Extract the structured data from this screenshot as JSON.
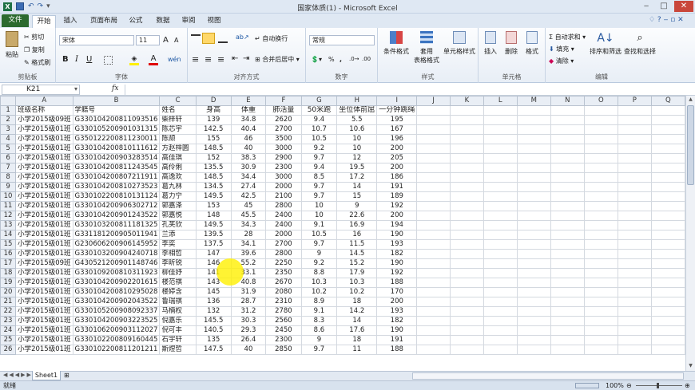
{
  "window": {
    "title": "国家体质(1)  -  Microsoft Excel"
  },
  "tabs": [
    "文件",
    "开始",
    "插入",
    "页面布局",
    "公式",
    "数据",
    "审阅",
    "视图"
  ],
  "ribbon": {
    "clipboard": {
      "label": "剪贴板",
      "paste": "粘贴",
      "cut": "剪切",
      "copy": "复制",
      "format_painter": "格式刷"
    },
    "font": {
      "label": "字体",
      "name": "宋体",
      "size": "11",
      "grow": "A",
      "shrink": "A",
      "bold": "B",
      "italic": "I",
      "underline": "U",
      "text_color": "A",
      "phonetic": "wén"
    },
    "alignment": {
      "label": "对齐方式",
      "wrap": "自动换行",
      "merge": "合并后居中"
    },
    "number": {
      "label": "数字",
      "format": "常规",
      "percent": "%"
    },
    "styles": {
      "label": "样式",
      "conditional": "条件格式",
      "table1": "套用",
      "table2": "表格格式",
      "cell_styles": "单元格样式"
    },
    "cells": {
      "label": "单元格",
      "insert": "插入",
      "delete": "删除",
      "format": "格式"
    },
    "editing": {
      "label": "编辑",
      "autosum": "自动求和",
      "fill": "填充",
      "clear": "清除",
      "sort": "排序和筛选",
      "find": "查找和选择"
    }
  },
  "formula_bar": {
    "name_box": "K21",
    "fx": "fx",
    "formula": ""
  },
  "columns": [
    "A",
    "B",
    "C",
    "D",
    "E",
    "F",
    "G",
    "H",
    "I",
    "J",
    "K",
    "L",
    "M",
    "N",
    "O",
    "P",
    "Q"
  ],
  "rows": [
    [
      "班级名称",
      "学籍号",
      "姓名",
      "身高",
      "体重",
      "肺活量",
      "50米跑",
      "坐位体前屈",
      "一分钟跳绳"
    ],
    [
      "小学2015级09班",
      "G330104200811093516",
      "柴梓轩",
      "139",
      "34.8",
      "2620",
      "9.4",
      "5.5",
      "195"
    ],
    [
      "小学2015级01班",
      "G330105200901031315",
      "陈芯宇",
      "142.5",
      "40.4",
      "2700",
      "10.7",
      "10.6",
      "167"
    ],
    [
      "小学2015级01班",
      "G350122200811230011",
      "陈颉",
      "155",
      "46",
      "3500",
      "10.5",
      "10",
      "196"
    ],
    [
      "小学2015级01班",
      "G330104200810111612",
      "方赵梓圆",
      "148.5",
      "40",
      "3000",
      "9.2",
      "10",
      "200"
    ],
    [
      "小学2015级01班",
      "G330104200903283514",
      "高佳琪",
      "152",
      "38.3",
      "2900",
      "9.7",
      "12",
      "205"
    ],
    [
      "小学2015级01班",
      "G330104200811243545",
      "高伶俐",
      "135.5",
      "30.9",
      "2300",
      "9.4",
      "19.5",
      "200"
    ],
    [
      "小学2015级01班",
      "G330104200807211911",
      "高逸欢",
      "148.5",
      "34.4",
      "3000",
      "8.5",
      "17.2",
      "186"
    ],
    [
      "小学2015级01班",
      "G330104200810273523",
      "葛九林",
      "134.5",
      "27.4",
      "2000",
      "9.7",
      "14",
      "191"
    ],
    [
      "小学2015级01班",
      "G330102200810131124",
      "葛力宁",
      "149.5",
      "42.5",
      "2100",
      "9.7",
      "15",
      "189"
    ],
    [
      "小学2015级01班",
      "G330104200906302712",
      "郭嘉泽",
      "153",
      "45",
      "2800",
      "10",
      "9",
      "192"
    ],
    [
      "小学2015级01班",
      "G330104200901243522",
      "郭嘉悦",
      "148",
      "45.5",
      "2400",
      "10",
      "22.6",
      "200"
    ],
    [
      "小学2015级01班",
      "G330103200811181325",
      "孔芙欣",
      "149.5",
      "34.3",
      "2400",
      "9.1",
      "16.9",
      "194"
    ],
    [
      "小学2015级01班",
      "G331181200905011941",
      "兰添",
      "139.5",
      "28",
      "2000",
      "10.5",
      "16",
      "190"
    ],
    [
      "小学2015级01班",
      "G230606200906145952",
      "李奕",
      "137.5",
      "34.1",
      "2700",
      "9.7",
      "11.5",
      "193"
    ],
    [
      "小学2015级01班",
      "G330103200904240718",
      "李相哲",
      "147",
      "39.6",
      "2800",
      "9",
      "14.5",
      "182"
    ],
    [
      "小学2015级09班",
      "G430521200901148746",
      "李昕锐",
      "146",
      "55.2",
      "2250",
      "9.2",
      "15.2",
      "190"
    ],
    [
      "小学2015级01班",
      "G330109200810311923",
      "柳佳妤",
      "141",
      "33.1",
      "2350",
      "8.8",
      "17.9",
      "192"
    ],
    [
      "小学2015级01班",
      "G330104200902201615",
      "楼范祺",
      "143",
      "40.8",
      "2670",
      "10.3",
      "10.3",
      "188"
    ],
    [
      "小学2015级01班",
      "G330104200810295028",
      "楼婷含",
      "145",
      "31.9",
      "2080",
      "10.2",
      "10.2",
      "170"
    ],
    [
      "小学2015级01班",
      "G330104200902043522",
      "鲁瑞祺",
      "136",
      "28.7",
      "2310",
      "8.9",
      "18",
      "200"
    ],
    [
      "小学2015级01班",
      "G330105200908092337",
      "马楠权",
      "132",
      "31.2",
      "2780",
      "9.1",
      "14.2",
      "193"
    ],
    [
      "小学2015级01班",
      "G330104200903223525",
      "倪嘉乐",
      "145.5",
      "30.3",
      "2560",
      "8.3",
      "14",
      "182"
    ],
    [
      "小学2015级01班",
      "G330106200903112027",
      "倪可丰",
      "140.5",
      "29.3",
      "2450",
      "8.6",
      "17.6",
      "190"
    ],
    [
      "小学2015级01班",
      "G330102200809160445",
      "石宇轩",
      "135",
      "26.4",
      "2300",
      "9",
      "18",
      "191"
    ],
    [
      "小学2015级01班",
      "G330102200811201211",
      "斯煜哲",
      "147.5",
      "40",
      "2850",
      "9.7",
      "11",
      "188"
    ]
  ],
  "sheet_tabs": [
    "Sheet1"
  ],
  "status": {
    "ready": "就绪",
    "zoom": "100%"
  }
}
